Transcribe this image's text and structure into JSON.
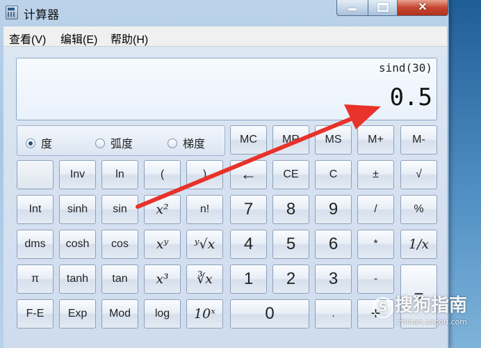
{
  "window": {
    "title": "计算器",
    "controls": {
      "minimize": "minimize-icon",
      "maximize": "maximize-icon",
      "close": "close-icon"
    }
  },
  "menu": [
    "查看(V)",
    "编辑(E)",
    "帮助(H)"
  ],
  "display": {
    "expression": "sind(30)",
    "result": "0.5"
  },
  "angle_modes": [
    {
      "label": "度",
      "selected": true
    },
    {
      "label": "弧度",
      "selected": false
    },
    {
      "label": "梯度",
      "selected": false
    }
  ],
  "memory_keys": [
    "MC",
    "MR",
    "MS",
    "M+",
    "M-"
  ],
  "keys": {
    "r2": [
      "",
      "Inv",
      "ln",
      "(",
      ")",
      "←",
      "CE",
      "C",
      "±",
      "√"
    ],
    "r3": [
      "Int",
      "sinh",
      "sin",
      "x²",
      "n!",
      "7",
      "8",
      "9",
      "/",
      "%"
    ],
    "r4": [
      "dms",
      "cosh",
      "cos",
      "xʸ",
      "ʸ√x",
      "4",
      "5",
      "6",
      "*",
      "1/x"
    ],
    "r5": [
      "π",
      "tanh",
      "tan",
      "x³",
      "∛x",
      "1",
      "2",
      "3",
      "-",
      "="
    ],
    "r6": [
      "F-E",
      "Exp",
      "Mod",
      "log",
      "10ˣ",
      "0",
      ".",
      "+"
    ]
  },
  "annotation": {
    "color": "#e8322a",
    "icon": "red-arrow-icon"
  },
  "watermark": {
    "logo_text": "搜狗指南",
    "logo_letter": "S",
    "url": "zhinan.sogou.com"
  }
}
